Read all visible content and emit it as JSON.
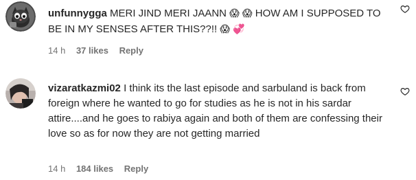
{
  "comments": [
    {
      "username": "unfunnygga",
      "text": "MERI JIND MERI JAANN",
      "emoji_1": "😱",
      "emoji_2": "😱",
      "text_2": "HOW AM I SUPPOSED TO BE IN MY SENSES AFTER THIS??!!",
      "emoji_3": "😱",
      "emoji_4": "💞",
      "time": "14 h",
      "likes": "37 likes",
      "reply": "Reply",
      "avatar_icon": "cat-avatar-icon",
      "like_icon": "heart-outline-icon"
    },
    {
      "username": "vizaratkazmi02",
      "text": "I think its the last episode and sarbuland is back from foreign where he wanted to go for studies as he is not in his sardar attire....and he goes to rabiya again and both of them are confessing their love so as for now they are not getting married",
      "time": "14 h",
      "likes": "184 likes",
      "reply": "Reply",
      "avatar_icon": "person-avatar-icon",
      "like_icon": "heart-outline-icon"
    }
  ]
}
